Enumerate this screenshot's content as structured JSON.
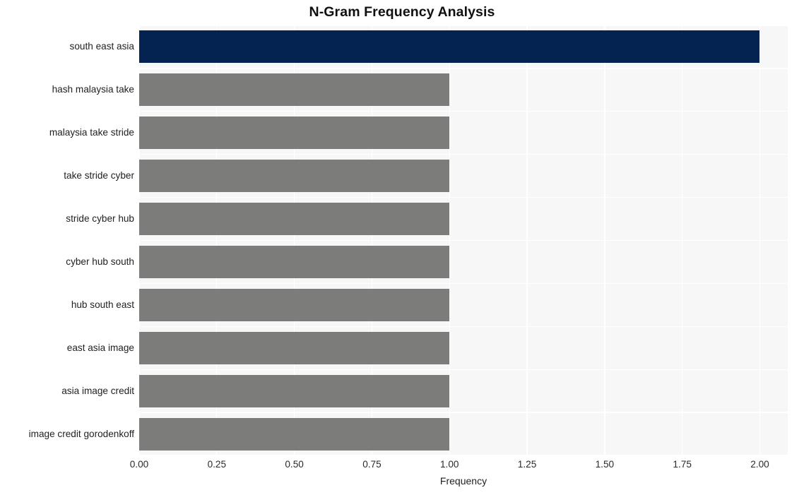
{
  "chart_data": {
    "type": "bar",
    "orientation": "horizontal",
    "title": "N-Gram Frequency Analysis",
    "xlabel": "Frequency",
    "ylabel": "",
    "categories": [
      "south east asia",
      "hash malaysia take",
      "malaysia take stride",
      "take stride cyber",
      "stride cyber hub",
      "cyber hub south",
      "hub south east",
      "east asia image",
      "asia image credit",
      "image credit gorodenkoff"
    ],
    "values": [
      2,
      1,
      1,
      1,
      1,
      1,
      1,
      1,
      1,
      1
    ],
    "bar_colors": [
      "#052351",
      "#7c7c7a",
      "#7c7c7a",
      "#7c7c7a",
      "#7c7c7a",
      "#7c7c7a",
      "#7c7c7a",
      "#7c7c7a",
      "#7c7c7a",
      "#7c7c7a"
    ],
    "highlight_color": "#052351",
    "default_bar_color": "#7c7c7a",
    "xlim": [
      0.0,
      2.09
    ],
    "xticks": [
      0.0,
      0.25,
      0.5,
      0.75,
      1.0,
      1.25,
      1.5,
      1.75,
      2.0
    ],
    "xtick_labels": [
      "0.00",
      "0.25",
      "0.50",
      "0.75",
      "1.00",
      "1.25",
      "1.50",
      "1.75",
      "2.00"
    ],
    "grid": true,
    "grid_color": "#ffffff",
    "plot_background": "#f7f7f7",
    "figure_background": "#ffffff",
    "legend": null,
    "legend_position": "none"
  }
}
